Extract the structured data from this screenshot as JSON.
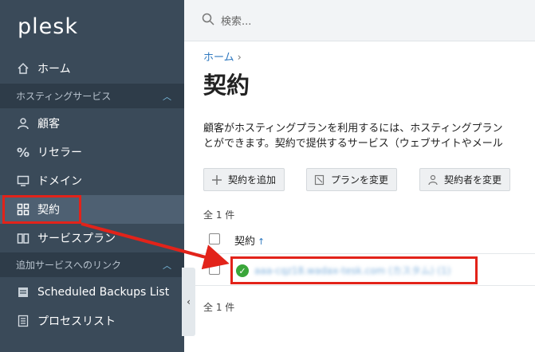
{
  "app": {
    "logo_text": "plesk"
  },
  "search": {
    "placeholder": "検索..."
  },
  "sidebar": {
    "items": [
      {
        "label": "ホーム",
        "icon": "home-icon"
      },
      {
        "label": "顧客",
        "icon": "user-icon"
      },
      {
        "label": "リセラー",
        "icon": "percent-icon"
      },
      {
        "label": "ドメイン",
        "icon": "monitor-icon"
      },
      {
        "label": "契約",
        "icon": "grid-icon"
      },
      {
        "label": "サービスプラン",
        "icon": "book-icon"
      },
      {
        "label": "Scheduled Backups List",
        "icon": "backup-icon"
      },
      {
        "label": "プロセスリスト",
        "icon": "list-icon"
      }
    ],
    "sections": [
      {
        "label": "ホスティングサービス"
      },
      {
        "label": "追加サービスへのリンク"
      }
    ],
    "active": "契約"
  },
  "main": {
    "breadcrumb": "ホーム",
    "title": "契約",
    "description_line1": "顧客がホスティングプランを利用するには、ホスティングプラン",
    "description_line2": "とができます。契約で提供するサービス（ウェブサイトやメール",
    "buttons": [
      {
        "label": "契約を追加",
        "icon": "plus-icon"
      },
      {
        "label": "プランを変更",
        "icon": "edit-doc-icon"
      },
      {
        "label": "契約者を変更",
        "icon": "person-change-icon"
      }
    ],
    "count_top": "全 1 件",
    "count_bottom": "全 1 件",
    "table": {
      "column_header": "契約",
      "sort_indicator": "↑",
      "rows": [
        {
          "name": "aaa-cqz18.wadax-tesk.com (カスタム) (1)",
          "status": "ok"
        }
      ]
    }
  },
  "colors": {
    "sidebar_bg": "#3a4a59",
    "accent_link": "#2f79c0",
    "highlight": "#e2231a",
    "status_ok": "#3aa63a"
  }
}
